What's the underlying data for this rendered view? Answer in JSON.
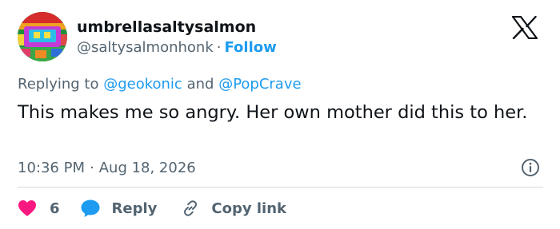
{
  "author": {
    "display_name": "umbrellasaltysalmon",
    "handle": "@saltysalmonhonk",
    "separator": "·",
    "follow_label": "Follow"
  },
  "reply_context": {
    "prefix": "Replying to",
    "mention_1": "@geokonic",
    "conjunction": "and",
    "mention_2": "@PopCrave"
  },
  "tweet": {
    "text": "This makes me so angry. Her own mother did this to her.",
    "time": "10:36 PM",
    "separator": "·",
    "date": "Aug 18, 2026"
  },
  "actions": {
    "like_count": "6",
    "reply_label": "Reply",
    "copy_label": "Copy link"
  },
  "icons": {
    "brand": "x-logo-icon",
    "info": "info-icon",
    "like": "heart-icon",
    "reply": "speech-bubble-icon",
    "copy": "link-icon"
  },
  "colors": {
    "accent": "#1d9bf0",
    "heart": "#f91880",
    "secondary_text": "#536471",
    "primary_text": "#0f1419",
    "divider": "#cfd9de"
  }
}
